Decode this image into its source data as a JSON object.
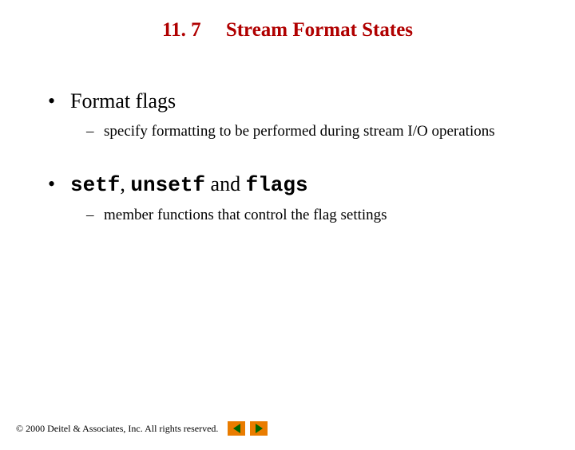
{
  "title": {
    "number": "11. 7",
    "text": "Stream Format States"
  },
  "bullets": [
    {
      "label": "Format flags",
      "sub": "specify formatting to be performed during stream I/O operations"
    },
    {
      "parts": {
        "code1": "setf",
        "sep1": ", ",
        "code2": "unsetf",
        "sep2": " and ",
        "code3": "flags"
      },
      "sub": "member functions that control the flag settings"
    }
  ],
  "footer": {
    "copyright": "© 2000 Deitel & Associates, Inc.  All rights reserved."
  }
}
